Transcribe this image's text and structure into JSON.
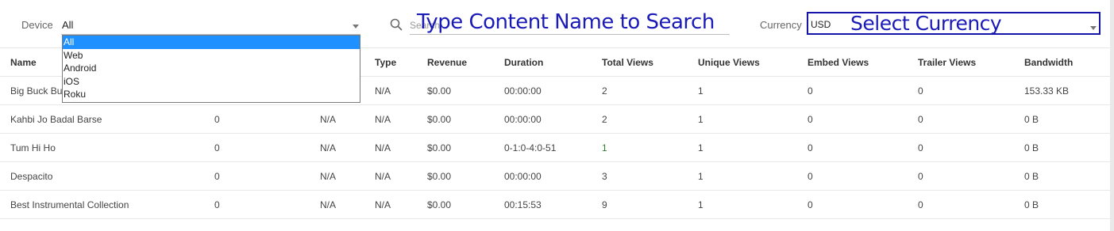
{
  "filters": {
    "device_label": "Device",
    "device_value": "All",
    "device_options": [
      "All",
      "Web",
      "Android",
      "iOS",
      "Roku"
    ],
    "search_placeholder": "Search",
    "search_annotation": "Type Content Name to Search",
    "currency_label": "Currency",
    "currency_value": "USD",
    "currency_annotation": "Select Currency"
  },
  "table": {
    "columns": [
      "Name",
      "",
      "",
      "Type",
      "Revenue",
      "Duration",
      "Total Views",
      "Unique Views",
      "Embed Views",
      "Trailer Views",
      "Bandwidth"
    ],
    "rows": [
      [
        "Big Buck Bunny",
        "",
        "",
        "N/A",
        "$0.00",
        "00:00:00",
        "2",
        "1",
        "0",
        "0",
        "153.33 KB"
      ],
      [
        "Kahbi Jo Badal Barse",
        "0",
        "N/A",
        "N/A",
        "$0.00",
        "00:00:00",
        "2",
        "1",
        "0",
        "0",
        "0 B"
      ],
      [
        "Tum Hi Ho",
        "0",
        "N/A",
        "N/A",
        "$0.00",
        "0-1:0-4:0-51",
        "1",
        "1",
        "0",
        "0",
        "0 B"
      ],
      [
        "Despacito",
        "0",
        "N/A",
        "N/A",
        "$0.00",
        "00:00:00",
        "3",
        "1",
        "0",
        "0",
        "0 B"
      ],
      [
        "Best Instrumental Collection",
        "0",
        "N/A",
        "N/A",
        "$0.00",
        "00:15:53",
        "9",
        "1",
        "0",
        "0",
        "0 B"
      ]
    ]
  },
  "colors": {
    "annotation": "#1a1ab8",
    "dropdown_selected": "#1e90ff",
    "currency_border": "#1414a8",
    "total_views_highlight": "#2e7d32"
  }
}
